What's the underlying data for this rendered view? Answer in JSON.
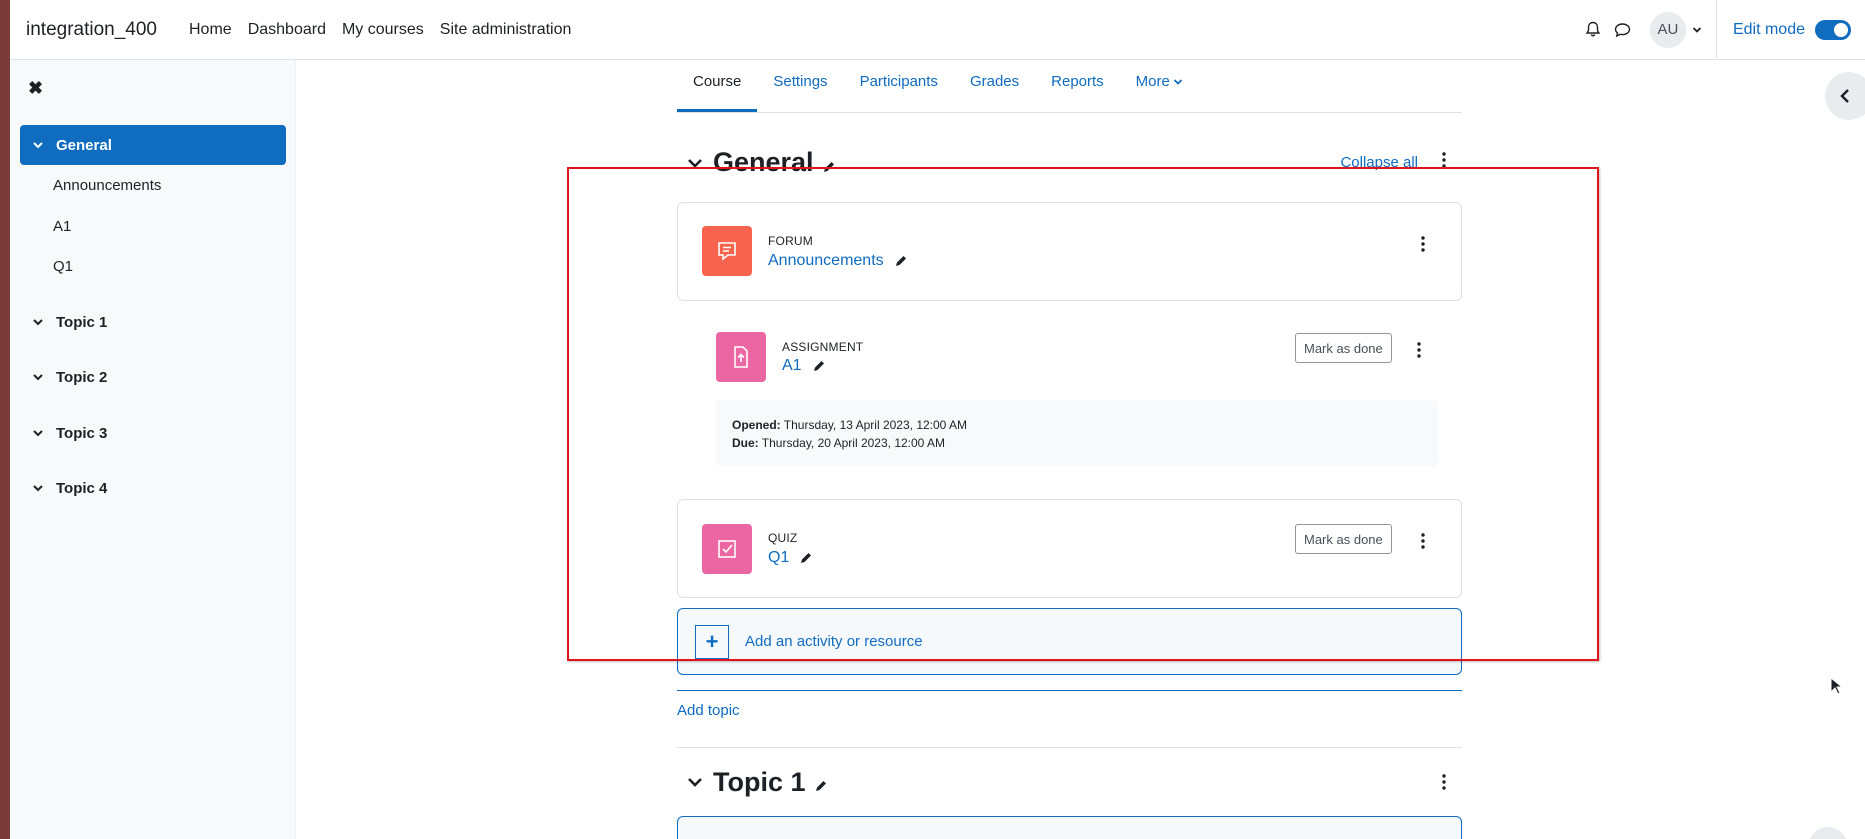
{
  "navbar": {
    "site_name": "integration_400",
    "links": [
      "Home",
      "Dashboard",
      "My courses",
      "Site administration"
    ],
    "avatar_initials": "AU",
    "edit_mode_label": "Edit mode",
    "edit_mode_on": true
  },
  "course_index": {
    "sections": [
      {
        "label": "General",
        "active": true,
        "items": [
          "Announcements",
          "A1",
          "Q1"
        ]
      },
      {
        "label": "Topic 1"
      },
      {
        "label": "Topic 2"
      },
      {
        "label": "Topic 3"
      },
      {
        "label": "Topic 4"
      }
    ]
  },
  "secondary_nav": {
    "tabs": [
      "Course",
      "Settings",
      "Participants",
      "Grades",
      "Reports",
      "More"
    ],
    "active": "Course"
  },
  "section_general": {
    "title": "General",
    "collapse_all": "Collapse all"
  },
  "activities": [
    {
      "type": "FORUM",
      "name": "Announcements",
      "icon": "forum-icon",
      "color": "#f7634d"
    },
    {
      "type": "ASSIGNMENT",
      "name": "A1",
      "icon": "assignment-icon",
      "color": "#eb66a2",
      "mark_done": "Mark as done",
      "dates": {
        "opened_label": "Opened:",
        "opened_value": "Thursday, 13 April 2023, 12:00 AM",
        "due_label": "Due:",
        "due_value": "Thursday, 20 April 2023, 12:00 AM"
      }
    },
    {
      "type": "QUIZ",
      "name": "Q1",
      "icon": "quiz-icon",
      "color": "#eb66a2",
      "mark_done": "Mark as done"
    }
  ],
  "add_activity_label": "Add an activity or resource",
  "add_topic_label": "Add topic",
  "next_section": {
    "title": "Topic 1"
  },
  "colors": {
    "primary": "#0f6cbf",
    "highlight": "#e0141c"
  }
}
